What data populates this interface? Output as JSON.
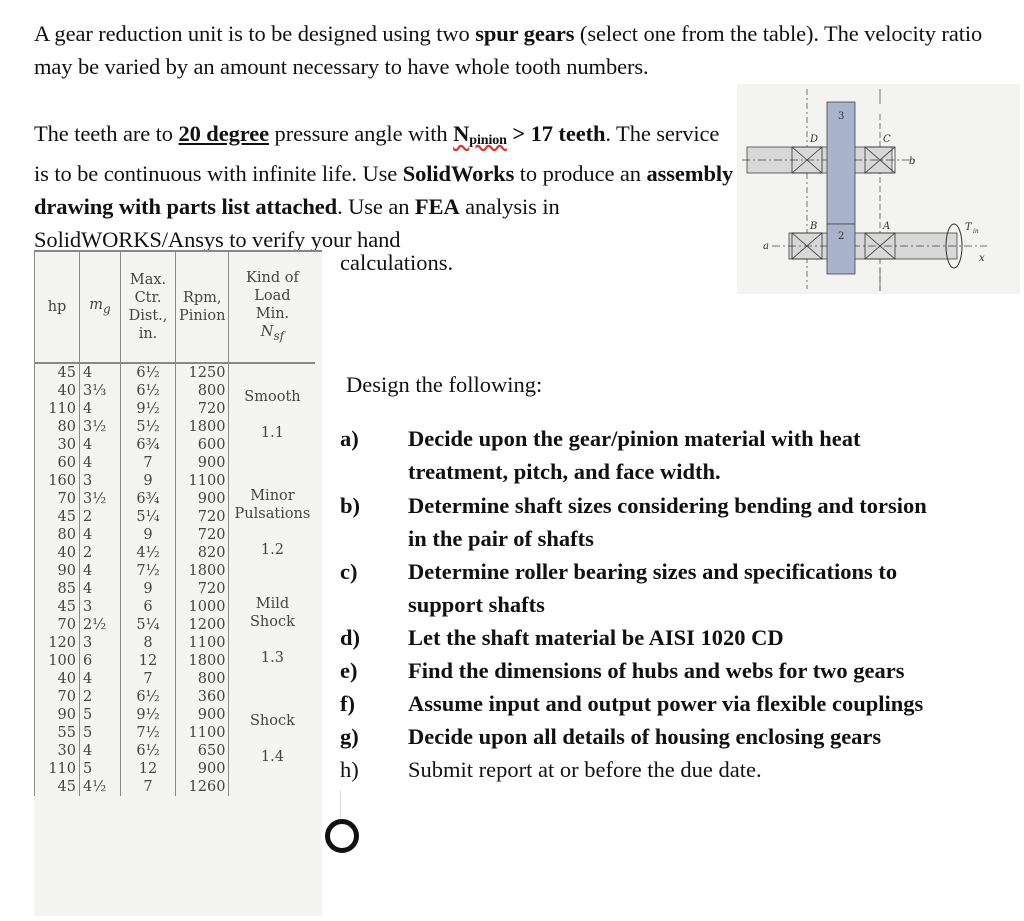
{
  "intro": {
    "p1_a": "A gear reduction unit is to be designed using two ",
    "p1_b": "spur gears",
    "p1_c": " (select one from the table). The velocity ratio may be varied by an amount necessary to have whole tooth numbers.",
    "p2_a": "The teeth are to ",
    "p2_b": "20 degree",
    "p2_c": " pressure angle with ",
    "p2_d": "N",
    "p2_e": "pinion",
    "p2_f": " > 17 teeth",
    "p2_g": ". The service is to be continuous with infinite life. Use ",
    "p2_h": "SolidWorks",
    "p2_i": " to produce an ",
    "p2_j": "assembly drawing with parts list attached",
    "p2_k": ". Use an ",
    "p2_l": "FEA",
    "p2_m": " analysis in ",
    "p2_n": "SolidWORKS",
    "p2_o": "/Ansys to verify your hand",
    "p2_p": "calculations."
  },
  "table": {
    "headers": [
      "hp",
      "m_g",
      "Max. Ctr. Dist., in.",
      "Rpm, Pinion",
      "Kind of Load Min. N_sf"
    ],
    "header_parts": {
      "hp": "hp",
      "mg": "m",
      "mg_sub": "g",
      "ctr_lines": [
        "Max.",
        "Ctr.",
        "Dist.,",
        "in."
      ],
      "rpm_lines": [
        "Rpm,",
        "Pinion"
      ],
      "kind_lines": [
        "Kind of",
        "Load",
        "Min."
      ],
      "nsf": "N",
      "nsf_sub": "sf"
    },
    "groups": [
      {
        "load": "Smooth",
        "nsf": "1.1",
        "rows": [
          {
            "hp": "45",
            "mg": "4",
            "ctr": "6½",
            "rpm": "1250"
          },
          {
            "hp": "40",
            "mg": "3⅓",
            "ctr": "6½",
            "rpm": "800"
          },
          {
            "hp": "110",
            "mg": "4",
            "ctr": "9½",
            "rpm": "720"
          },
          {
            "hp": "80",
            "mg": "3½",
            "ctr": "5½",
            "rpm": "1800"
          },
          {
            "hp": "30",
            "mg": "4",
            "ctr": "6¾",
            "rpm": "600"
          },
          {
            "hp": "60",
            "mg": "4",
            "ctr": "7",
            "rpm": "900"
          }
        ]
      },
      {
        "load": "Minor Pulsations",
        "nsf": "1.2",
        "rows": [
          {
            "hp": "160",
            "mg": "3",
            "ctr": "9",
            "rpm": "1100"
          },
          {
            "hp": "70",
            "mg": "3½",
            "ctr": "6¾",
            "rpm": "900"
          },
          {
            "hp": "45",
            "mg": "2",
            "ctr": "5¼",
            "rpm": "720"
          },
          {
            "hp": "80",
            "mg": "4",
            "ctr": "9",
            "rpm": "720"
          },
          {
            "hp": "40",
            "mg": "2",
            "ctr": "4½",
            "rpm": "820"
          },
          {
            "hp": "90",
            "mg": "4",
            "ctr": "7½",
            "rpm": "1800"
          }
        ]
      },
      {
        "load": "Mild Shock",
        "nsf": "1.3",
        "rows": [
          {
            "hp": "85",
            "mg": "4",
            "ctr": "9",
            "rpm": "720"
          },
          {
            "hp": "45",
            "mg": "3",
            "ctr": "6",
            "rpm": "1000"
          },
          {
            "hp": "70",
            "mg": "2½",
            "ctr": "5¼",
            "rpm": "1200"
          },
          {
            "hp": "120",
            "mg": "3",
            "ctr": "8",
            "rpm": "1100"
          },
          {
            "hp": "100",
            "mg": "6",
            "ctr": "12",
            "rpm": "1800"
          },
          {
            "hp": "40",
            "mg": "4",
            "ctr": "7",
            "rpm": "800"
          }
        ]
      },
      {
        "load": "Shock",
        "nsf": "1.4",
        "rows": [
          {
            "hp": "70",
            "mg": "2",
            "ctr": "6½",
            "rpm": "360"
          },
          {
            "hp": "90",
            "mg": "5",
            "ctr": "9½",
            "rpm": "900"
          },
          {
            "hp": "55",
            "mg": "5",
            "ctr": "7½",
            "rpm": "1100"
          },
          {
            "hp": "30",
            "mg": "4",
            "ctr": "6½",
            "rpm": "650"
          },
          {
            "hp": "110",
            "mg": "5",
            "ctr": "12",
            "rpm": "900"
          },
          {
            "hp": "45",
            "mg": "4½",
            "ctr": "7",
            "rpm": "1260"
          }
        ]
      }
    ]
  },
  "design": {
    "heading": "Design the following:",
    "items": [
      {
        "label": "a)",
        "lines": [
          "Decide upon the gear/pinion material with heat",
          "treatment, pitch, and face width."
        ]
      },
      {
        "label": "b)",
        "lines": [
          " Determine shaft sizes considering bending and torsion",
          "in the pair of shafts"
        ]
      },
      {
        "label": "c)",
        "lines": [
          "Determine roller bearing sizes and specifications to",
          "support shafts"
        ]
      },
      {
        "label": "d)",
        "lines": [
          "Let the shaft material be AISI 1020 CD"
        ]
      },
      {
        "label": "e)",
        "lines": [
          "Find the dimensions of hubs and webs for two gears"
        ]
      },
      {
        "label": "f)",
        "lines": [
          "Assume input and output power via flexible couplings"
        ]
      },
      {
        "label": "g)",
        "lines": [
          "Decide upon all details of housing enclosing gears"
        ]
      },
      {
        "label": "h)",
        "lines": [
          "Submit report at or before the due date."
        ]
      }
    ]
  },
  "diagram": {
    "labels": {
      "gear3": "3",
      "gear2": "2",
      "bearingD": "D",
      "bearingC": "C",
      "bearingB": "B",
      "bearingA": "A",
      "shaft_b": "b",
      "shaft_a": "a",
      "axis_x": "x",
      "torque": "T",
      "torque_sub": "in"
    },
    "colors": {
      "gear": "#a9b3cc",
      "shaft": "#d9d9d9",
      "line": "#444444"
    }
  }
}
